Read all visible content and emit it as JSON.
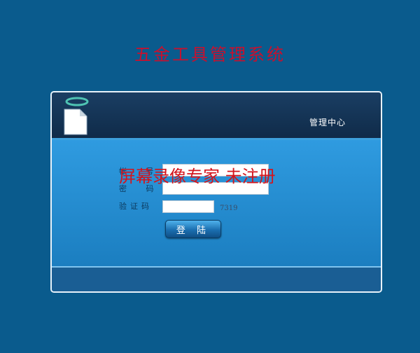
{
  "page": {
    "title": "五金工具管理系统"
  },
  "header": {
    "center_label": "管理中心"
  },
  "form": {
    "username_label": "帐 号",
    "password_label": "密 码",
    "captcha_label": "验证码",
    "username_value": "",
    "password_value": "",
    "captcha_value": "",
    "captcha_code": "7319",
    "login_label": "登 陆"
  },
  "overlay": {
    "watermark": "屏幕录像专家  未注册"
  },
  "colors": {
    "background": "#0a5b8d",
    "title": "#c8102e",
    "panel_body": "#2f9be0",
    "watermark": "#d4141c"
  },
  "icons": {
    "logo": "document-icon"
  }
}
